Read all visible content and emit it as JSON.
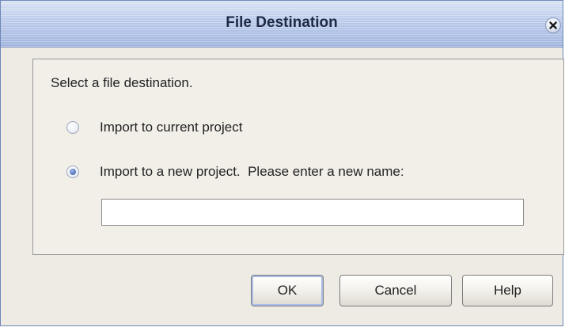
{
  "dialog": {
    "title": "File Destination",
    "close_icon": "close-icon",
    "prompt": "Select a file destination.",
    "options": [
      {
        "label": "Import to current project",
        "selected": false
      },
      {
        "label": "Import to a new project.  Please enter a new name:",
        "selected": true
      }
    ],
    "name_input": {
      "value": "",
      "placeholder": ""
    },
    "buttons": {
      "ok": "OK",
      "cancel": "Cancel",
      "help": "Help"
    }
  },
  "colors": {
    "titlebar": "#b9c9ea",
    "window_bg": "#eeeae4",
    "radio_selected": "#4b6fb7",
    "default_button_ring": "#a9bde6"
  }
}
